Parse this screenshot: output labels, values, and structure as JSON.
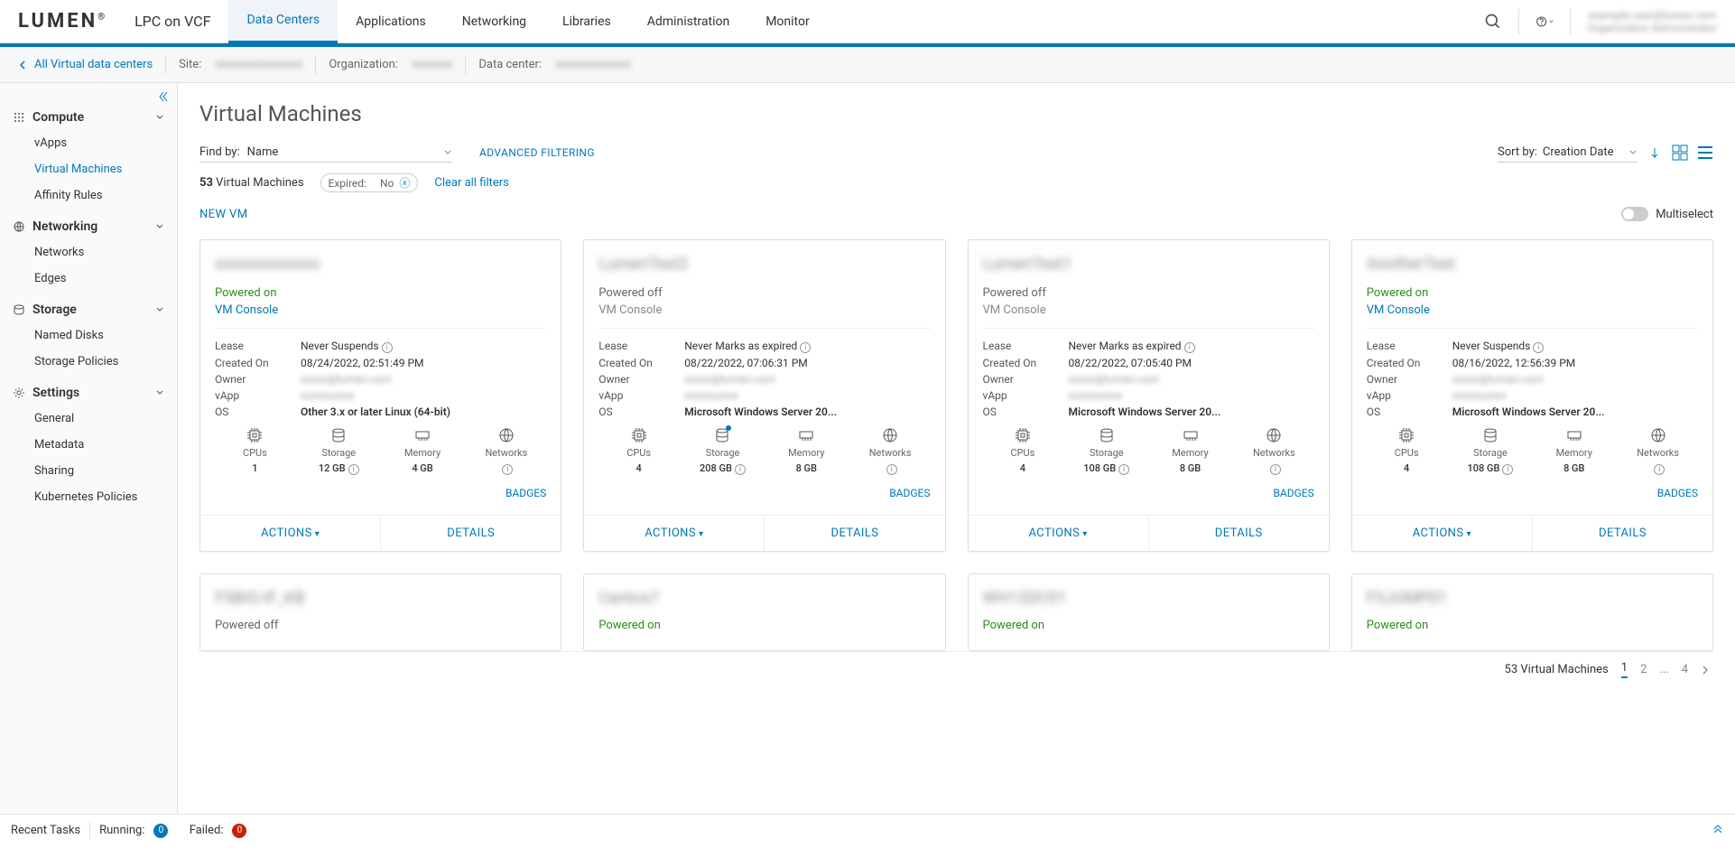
{
  "logo": "LUMEN",
  "product": "LPC on VCF",
  "nav": [
    "Data Centers",
    "Applications",
    "Networking",
    "Libraries",
    "Administration",
    "Monitor"
  ],
  "user_email": "example.user@lumen.com",
  "user_role": "Organization Administrator",
  "breadcrumb": {
    "back": "All Virtual data centers",
    "site_lbl": "Site:",
    "site_val": "xxxxxxxxxxxxxxx",
    "org_lbl": "Organization:",
    "org_val": "xxxxxxx",
    "dc_lbl": "Data center:",
    "dc_val": "xxxxxxxxxxxxx"
  },
  "sidebar": {
    "compute": "Compute",
    "vapps": "vApps",
    "vms": "Virtual Machines",
    "affinity": "Affinity Rules",
    "networking": "Networking",
    "networks": "Networks",
    "edges": "Edges",
    "storage": "Storage",
    "named_disks": "Named Disks",
    "storage_policies": "Storage Policies",
    "settings": "Settings",
    "general": "General",
    "metadata": "Metadata",
    "sharing": "Sharing",
    "kubernetes": "Kubernetes Policies"
  },
  "page_title": "Virtual Machines",
  "find_by_lbl": "Find by:",
  "find_by_val": "Name",
  "advanced_filtering": "ADVANCED FILTERING",
  "sort_by_lbl": "Sort by:",
  "sort_by_val": "Creation Date",
  "count_num": "53",
  "count_lbl": "Virtual Machines",
  "expired_lbl": "Expired:",
  "expired_val": "No",
  "clear_filters": "Clear all filters",
  "new_vm": "NEW VM",
  "multiselect": "Multiselect",
  "vm_console": "VM Console",
  "lease_lbl": "Lease",
  "created_lbl": "Created On",
  "owner_lbl": "Owner",
  "vapp_lbl": "vApp",
  "os_lbl": "OS",
  "cpus_lbl": "CPUs",
  "storage_lbl": "Storage",
  "memory_lbl": "Memory",
  "networks_lbl": "Networks",
  "badges": "BADGES",
  "actions": "ACTIONS",
  "details": "DETAILS",
  "powered_on": "Powered on",
  "powered_off": "Powered off",
  "cards": [
    {
      "title": "xxxxxxxxxxxxx",
      "status": "on",
      "console": true,
      "lease": "Never Suspends",
      "created": "08/24/2022, 02:51:49 PM",
      "os": "Other 3.x or later Linux (64-bit)",
      "cpus": "1",
      "storage": "12 GB",
      "memory": "4 GB",
      "net_info": true,
      "storage_dot": false
    },
    {
      "title": "LumenTest2",
      "status": "off",
      "console": false,
      "lease": "Never Marks as expired",
      "created": "08/22/2022, 07:06:31 PM",
      "os": "Microsoft Windows Server 20...",
      "cpus": "4",
      "storage": "208 GB",
      "memory": "8 GB",
      "net_info": true,
      "storage_dot": true
    },
    {
      "title": "LumenTest1",
      "status": "off",
      "console": false,
      "lease": "Never Marks as expired",
      "created": "08/22/2022, 07:05:40 PM",
      "os": "Microsoft Windows Server 20...",
      "cpus": "4",
      "storage": "108 GB",
      "memory": "8 GB",
      "net_info": true,
      "storage_dot": false
    },
    {
      "title": "AnotherTest",
      "status": "on",
      "console": true,
      "lease": "Never Suspends",
      "created": "08/16/2022, 12:56:39 PM",
      "os": "Microsoft Windows Server 20...",
      "cpus": "4",
      "storage": "108 GB",
      "memory": "8 GB",
      "net_info": true,
      "storage_dot": false
    }
  ],
  "stubs": [
    {
      "title": "FSBIO-IF_KB",
      "status": "off"
    },
    {
      "title": "Centos7",
      "status": "on"
    },
    {
      "title": "WH12DC01",
      "status": "on"
    },
    {
      "title": "FSJUMP01",
      "status": "on"
    }
  ],
  "pagination": {
    "total": "53 Virtual Machines",
    "pages": [
      "1",
      "2",
      "...",
      "4"
    ]
  },
  "footer": {
    "recent": "Recent Tasks",
    "running": "Running:",
    "running_n": "0",
    "failed": "Failed:",
    "failed_n": "0"
  }
}
